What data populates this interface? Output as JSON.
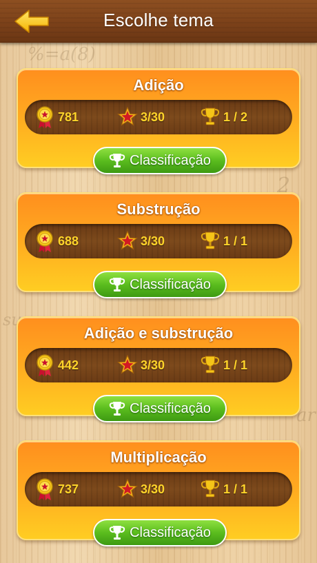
{
  "header": {
    "title": "Escolhe tema",
    "back_icon": "arrow-left-icon"
  },
  "colors": {
    "header_wood": "#7a4019",
    "card_orange": "#ff8f1e",
    "card_yellow": "#ffcd22",
    "stats_value": "#ffd42a",
    "button_green": "#5bbd1e"
  },
  "topics": [
    {
      "title": "Adição",
      "points": "781",
      "stars": "3/30",
      "trophies": "1 / 2",
      "button_label": "Classificação"
    },
    {
      "title": "Substrução",
      "points": "688",
      "stars": "3/30",
      "trophies": "1 / 1",
      "button_label": "Classificação"
    },
    {
      "title": "Adição e substrução",
      "points": "442",
      "stars": "3/30",
      "trophies": "1 / 1",
      "button_label": "Classificação"
    },
    {
      "title": "Multiplicação",
      "points": "737",
      "stars": "3/30",
      "trophies": "1 / 1",
      "button_label": "Classificação"
    }
  ]
}
